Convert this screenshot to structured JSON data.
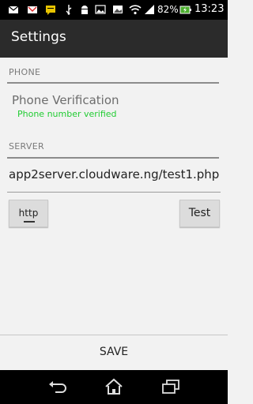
{
  "status_bar": {
    "battery": "82%",
    "time": "13:23"
  },
  "action_bar": {
    "title": "Settings"
  },
  "phone_section": {
    "header": "PHONE",
    "item_title": "Phone Verification",
    "item_summary": "Phone number verified"
  },
  "server_section": {
    "header": "SERVER",
    "url": "app2server.cloudware.ng/test1.php"
  },
  "buttons": {
    "protocol": "http",
    "test": "Test",
    "save": "SAVE"
  },
  "colors": {
    "accent_green": "#22cc33",
    "action_bar": "#2b2b2b"
  }
}
